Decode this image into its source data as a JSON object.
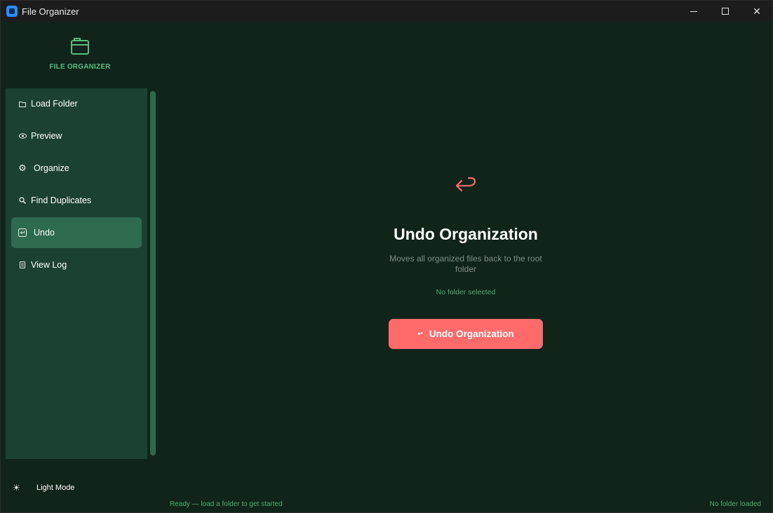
{
  "window": {
    "title": "File Organizer"
  },
  "sidebar": {
    "brand": "FILE ORGANIZER",
    "items": [
      {
        "label": "Load Folder",
        "icon": "folder-icon"
      },
      {
        "label": "Preview",
        "icon": "eye-icon"
      },
      {
        "label": "Organize",
        "icon": "gear-icon"
      },
      {
        "label": "Find Duplicates",
        "icon": "magnifier-icon"
      },
      {
        "label": "Undo",
        "icon": "undo-icon",
        "active": true
      },
      {
        "label": "View Log",
        "icon": "log-icon"
      }
    ],
    "theme_toggle": "Light Mode"
  },
  "main": {
    "title": "Undo Organization",
    "subtitle": "Moves all organized files back to the root folder",
    "status": "No folder selected",
    "button_label": "Undo Organization"
  },
  "statusbar": {
    "left": "Ready — load a folder to get started",
    "right": "No folder loaded"
  },
  "colors": {
    "accent": "#ff6b6b",
    "sidebar": "#1b4230",
    "background": "#10241a",
    "highlight_text": "#4fae70"
  }
}
